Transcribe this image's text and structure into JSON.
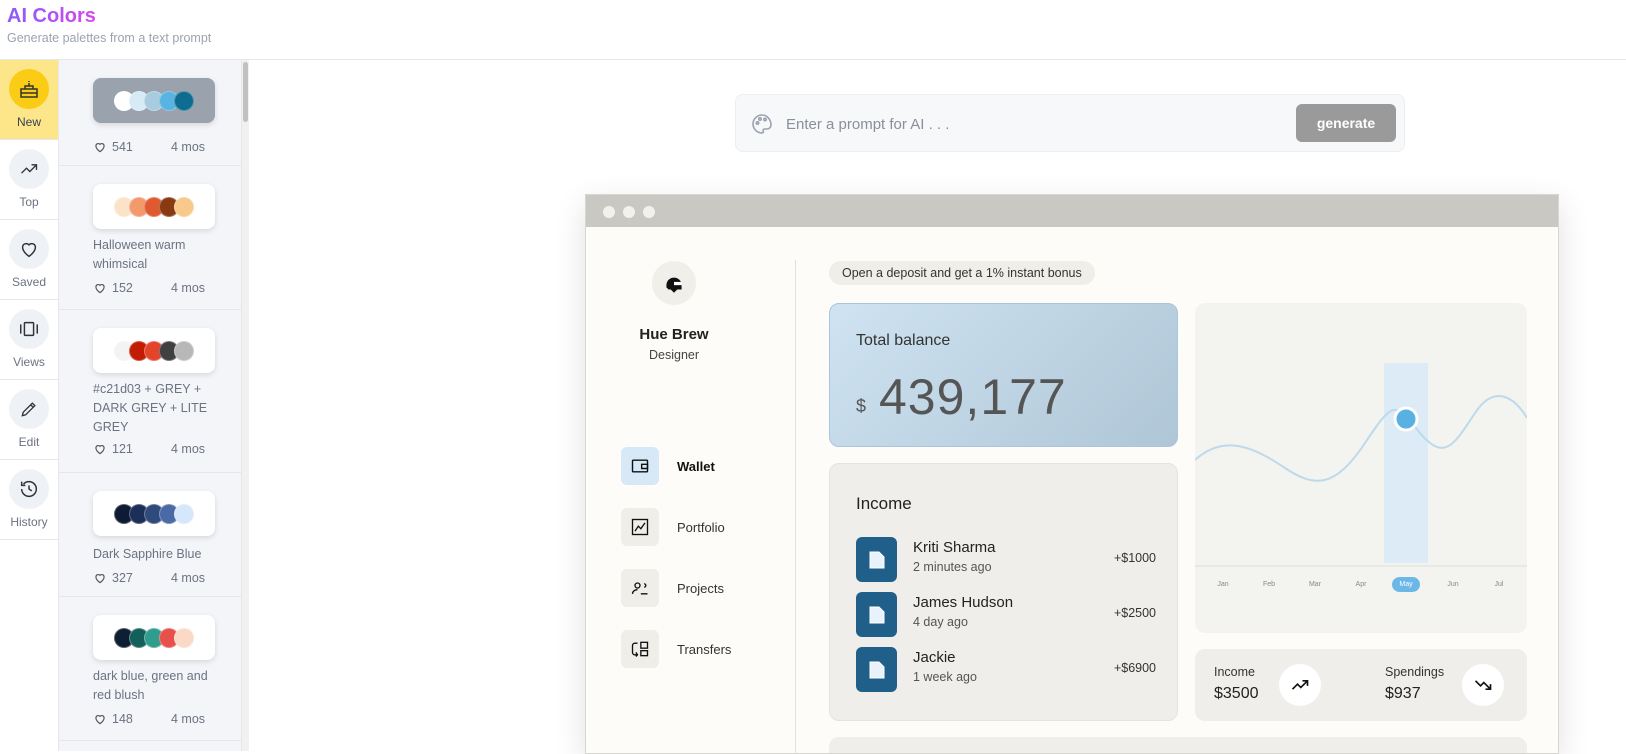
{
  "app": {
    "title": "AI Colors",
    "subtitle": "Generate palettes from a text prompt"
  },
  "nav": [
    {
      "label": "New",
      "icon": "cake-icon",
      "active": true
    },
    {
      "label": "Top",
      "icon": "trending-up-icon"
    },
    {
      "label": "Saved",
      "icon": "heart-icon"
    },
    {
      "label": "Views",
      "icon": "carousel-icon"
    },
    {
      "label": "Edit",
      "icon": "pencil-icon"
    },
    {
      "label": "History",
      "icon": "history-icon"
    }
  ],
  "palettes": [
    {
      "name": "",
      "colors": [
        "#ffffff",
        "#d6ebf5",
        "#a9cbe0",
        "#5ab4e2",
        "#0d6c8f"
      ],
      "likes": "541",
      "age": "4 mos",
      "highlight": true
    },
    {
      "name": "Halloween warm whimsical",
      "colors": [
        "#fbe3c7",
        "#f29a6b",
        "#e05a31",
        "#8a3a12",
        "#f7c98b"
      ],
      "likes": "152",
      "age": "4 mos"
    },
    {
      "name": "#c21d03 + GREY + DARK GREY + LITE GREY",
      "colors": [
        "#f3f3f3",
        "#c21d03",
        "#e4452a",
        "#404040",
        "#b8b8b8"
      ],
      "likes": "121",
      "age": "4 mos"
    },
    {
      "name": "Dark Sapphire Blue",
      "colors": [
        "#0f1a33",
        "#1c2f58",
        "#2f4b7c",
        "#4a6aa6",
        "#d6e7fb"
      ],
      "likes": "327",
      "age": "4 mos"
    },
    {
      "name": "dark blue, green and red blush",
      "colors": [
        "#0f1f33",
        "#145f5c",
        "#2f9c8e",
        "#e8514b",
        "#fbd9c7"
      ],
      "likes": "148",
      "age": "4 mos"
    }
  ],
  "prompt": {
    "placeholder": "Enter a prompt for AI . . .",
    "button": "generate"
  },
  "preview": {
    "user": {
      "name": "Hue Brew",
      "role": "Designer"
    },
    "menu": [
      {
        "label": "Wallet",
        "icon": "wallet-icon",
        "active": true
      },
      {
        "label": "Portfolio",
        "icon": "chart-icon"
      },
      {
        "label": "Projects",
        "icon": "people-icon"
      },
      {
        "label": "Transfers",
        "icon": "transfer-icon"
      }
    ],
    "promo": "Open a deposit and get a 1% instant bonus",
    "balance": {
      "label": "Total balance",
      "currency": "$",
      "amount": "439,177"
    },
    "income": {
      "title": "Income",
      "items": [
        {
          "name": "Kriti Sharma",
          "time": "2 minutes ago",
          "amount": "+$1000"
        },
        {
          "name": "James Hudson",
          "time": "4 day ago",
          "amount": "+$2500"
        },
        {
          "name": "Jackie",
          "time": "1 week ago",
          "amount": "+$6900"
        }
      ]
    },
    "chart": {
      "months": [
        "Jan",
        "Feb",
        "Mar",
        "Apr",
        "May",
        "Jun",
        "Jul"
      ],
      "selected": "May"
    },
    "stats": {
      "income_label": "Income",
      "income_value": "$3500",
      "spend_label": "Spendings",
      "spend_value": "$937"
    }
  }
}
